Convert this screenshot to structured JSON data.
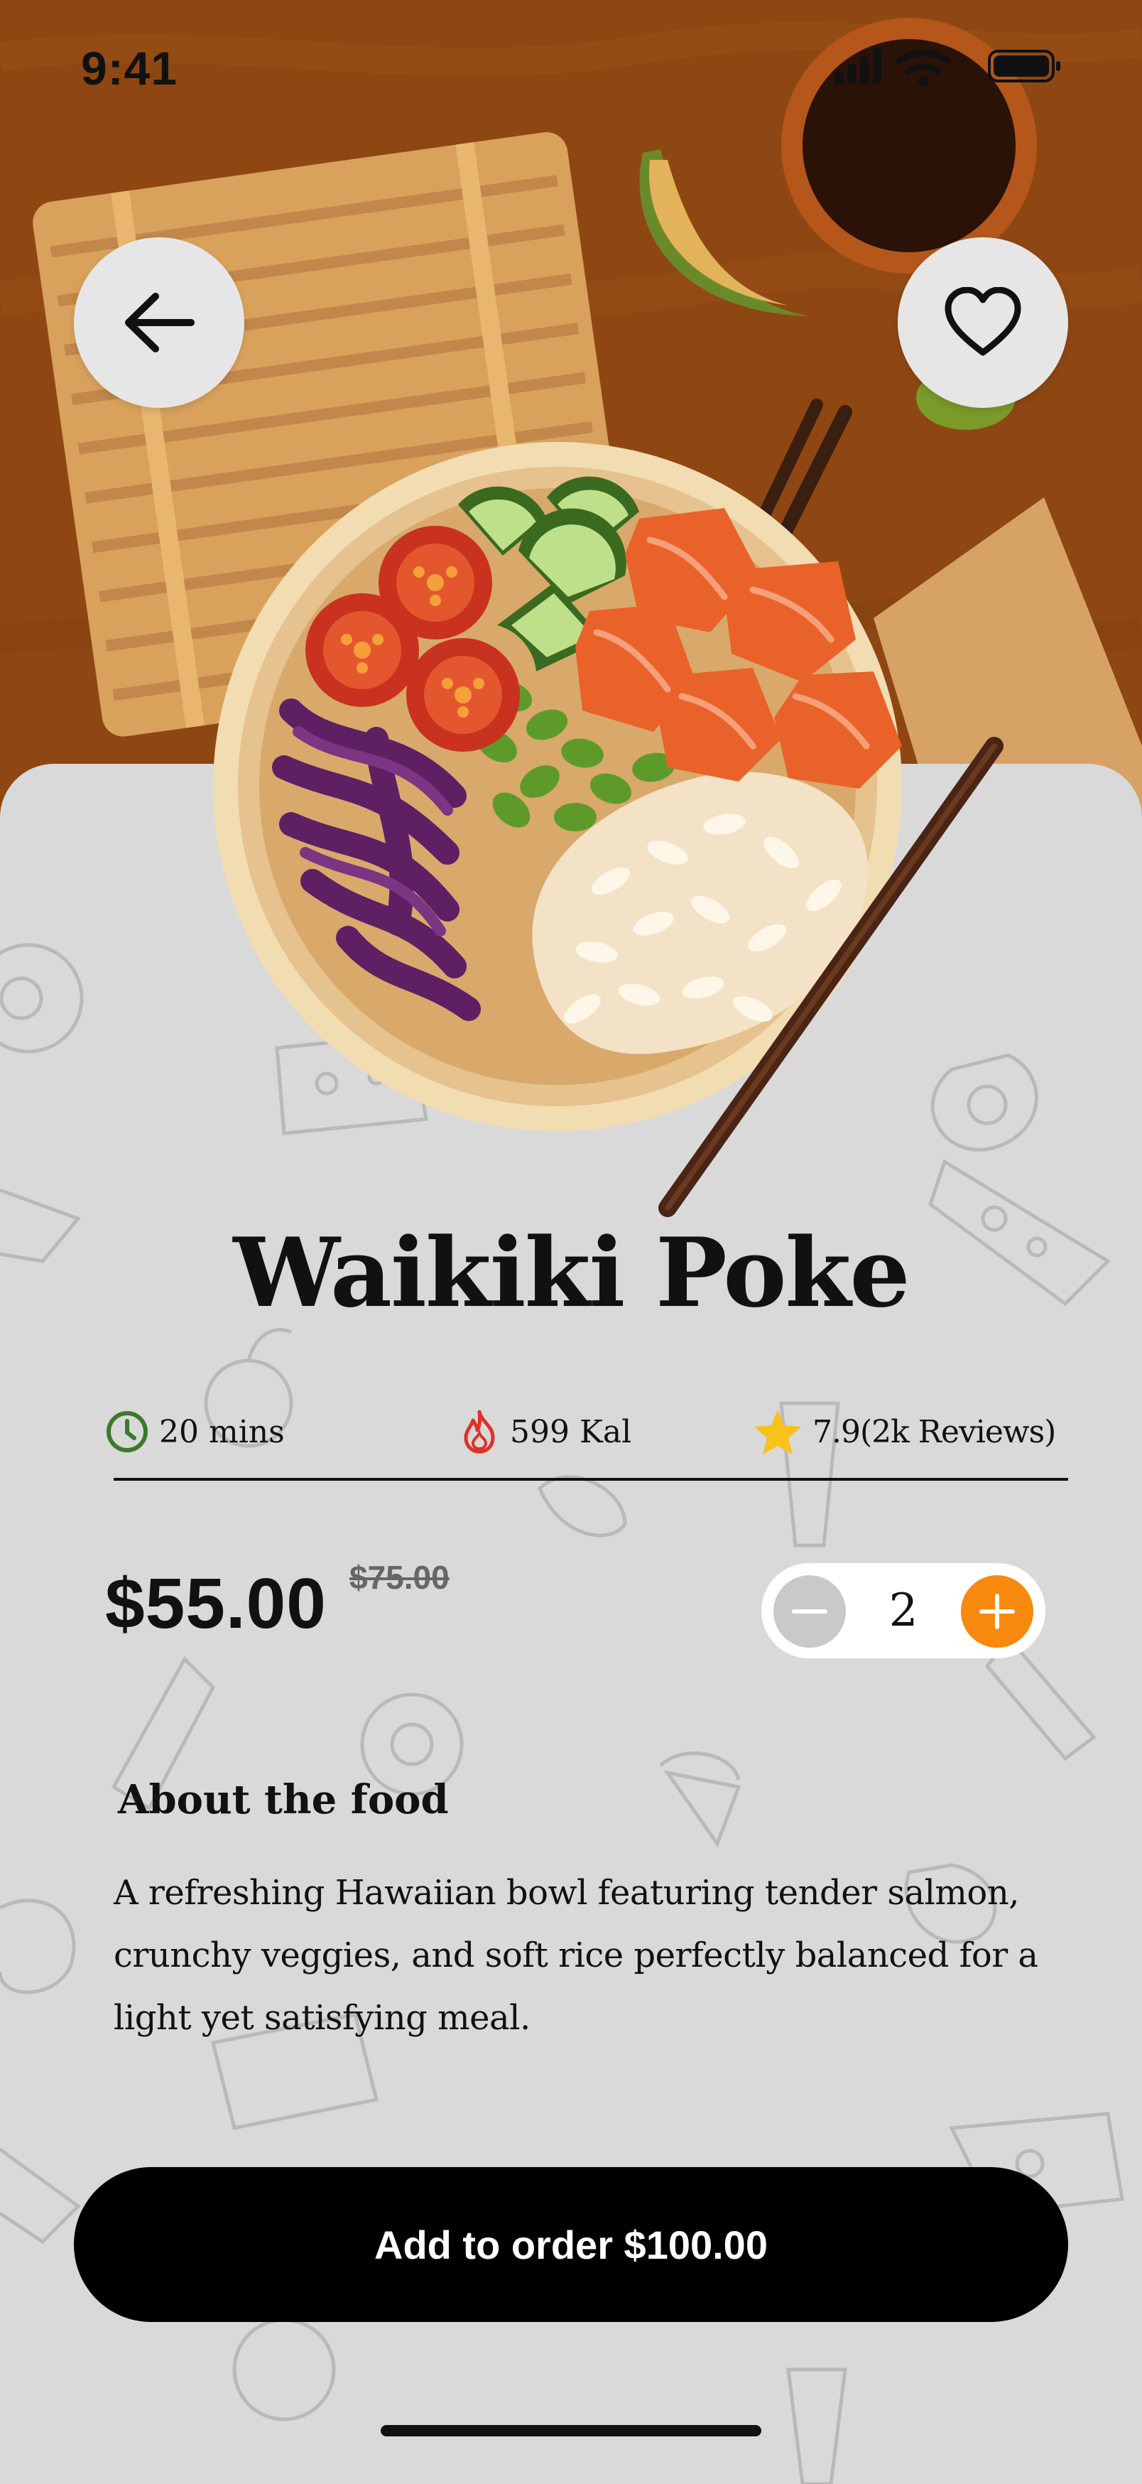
{
  "status_bar": {
    "time": "9:41"
  },
  "header": {
    "back_icon": "arrow-left-icon",
    "favorite_icon": "heart-icon"
  },
  "food": {
    "name": "Waikiki Poke",
    "time": "20 mins",
    "calories": "599 Kal",
    "rating": "7.9(2k Reviews)",
    "price": "$55.00",
    "old_price": "$75.00",
    "quantity": "2",
    "about_title": "About the food",
    "description": "A refreshing Hawaiian bowl featuring tender salmon, crunchy veggies, and soft rice  perfectly balanced for a light yet satisfying meal."
  },
  "cta": {
    "label": "Add to order $100.00"
  },
  "colors": {
    "accent": "#f7890e",
    "background": "#d9d9da",
    "table": "#8e4712",
    "cta": "#000000",
    "star": "#f7c21a",
    "clock": "#3a7a2a",
    "flame": "#e0302a"
  }
}
